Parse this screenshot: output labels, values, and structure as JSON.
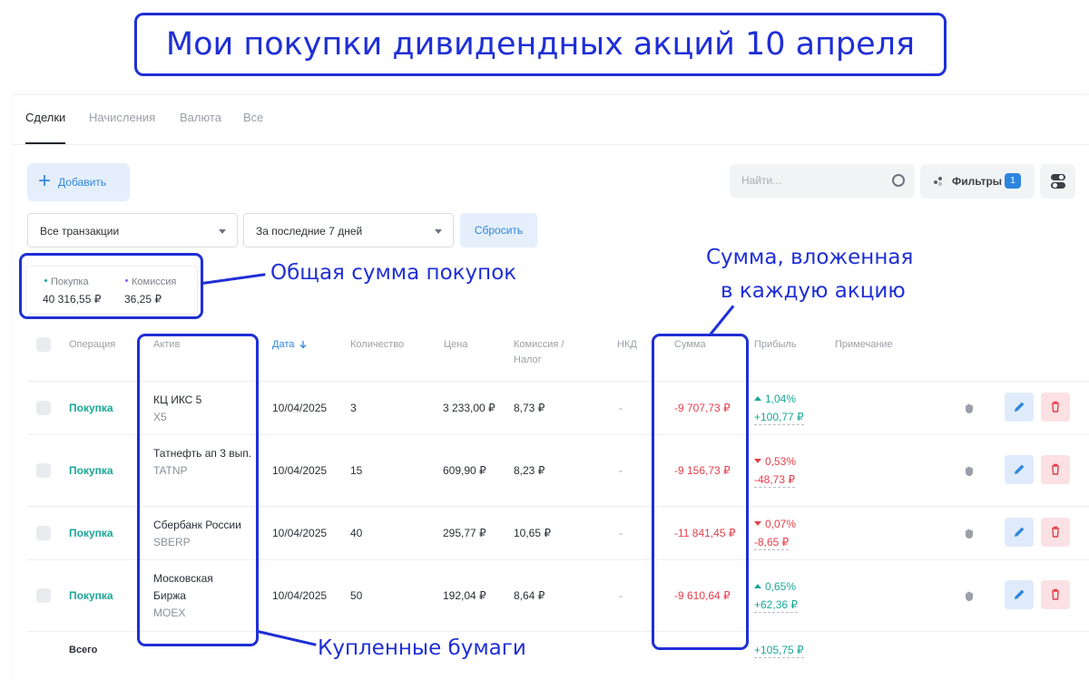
{
  "banner": {
    "title": "Мои покупки дивидендных акций 10 апреля"
  },
  "tabs": [
    {
      "label": "Сделки",
      "active": true
    },
    {
      "label": "Начисления",
      "active": false
    },
    {
      "label": "Валюта",
      "active": false
    },
    {
      "label": "Все",
      "active": false
    }
  ],
  "toolbar": {
    "add_label": "Добавить",
    "search_placeholder": "Найти...",
    "filters_label": "Фильтры",
    "filters_count": "1",
    "transaction_type": "Все транзакции",
    "period": "За последние 7 дней",
    "reset_label": "Сбросить"
  },
  "summary": {
    "buy_label": "Покупка",
    "buy_value": "40 316,55 ₽",
    "buy_color": "#1aa89a",
    "commission_label": "Комиссия",
    "commission_value": "36,25 ₽",
    "commission_color": "#8b5cf6"
  },
  "columns": {
    "operation": "Операция",
    "asset": "Актив",
    "date": "Дата",
    "quantity": "Количество",
    "price": "Цена",
    "commission_1": "Комиссия /",
    "commission_2": "Налог",
    "nkd": "НКД",
    "sum": "Сумма",
    "profit": "Прибыль",
    "note": "Примечание"
  },
  "rows": [
    {
      "operation": "Покупка",
      "asset_name": "КЦ ИКС 5",
      "ticker": "X5",
      "date": "10/04/2025",
      "quantity": "3",
      "price": "3 233,00 ₽",
      "commission": "8,73 ₽",
      "nkd": "-",
      "sum": "-9 707,73 ₽",
      "profit_pct": "1,04%",
      "profit_abs": "+100,77 ₽",
      "direction": "up"
    },
    {
      "operation": "Покупка",
      "asset_name": "Татнефть ап 3 вып.",
      "ticker": "TATNP",
      "date": "10/04/2025",
      "quantity": "15",
      "price": "609,90 ₽",
      "commission": "8,23 ₽",
      "nkd": "-",
      "sum": "-9 156,73 ₽",
      "profit_pct": "0,53%",
      "profit_abs": "-48,73 ₽",
      "direction": "down"
    },
    {
      "operation": "Покупка",
      "asset_name": "Сбербанк России",
      "ticker": "SBERP",
      "date": "10/04/2025",
      "quantity": "40",
      "price": "295,77 ₽",
      "commission": "10,65 ₽",
      "nkd": "-",
      "sum": "-11 841,45 ₽",
      "profit_pct": "0,07%",
      "profit_abs": "-8,65 ₽",
      "direction": "down"
    },
    {
      "operation": "Покупка",
      "asset_name": "Московская Биржа",
      "ticker": "MOEX",
      "date": "10/04/2025",
      "quantity": "50",
      "price": "192,04 ₽",
      "commission": "8,64 ₽",
      "nkd": "-",
      "sum": "-9 610,64 ₽",
      "profit_pct": "0,65%",
      "profit_abs": "+62,36 ₽",
      "direction": "up"
    }
  ],
  "total": {
    "label": "Всего",
    "profit": "+105,75 ₽"
  },
  "annotations": {
    "total_buys": "Общая сумма покупок",
    "sum_per_stock_1": "Сумма, вложенная",
    "sum_per_stock_2": "в каждую акцию",
    "bought_papers": "Купленные бумаги"
  },
  "colors": {
    "accent": "#2e86de",
    "annotation": "#1f2fd6",
    "positive": "#1aa89a",
    "negative": "#e53e4a"
  },
  "icons": {
    "add": "plus-icon",
    "search": "search-icon",
    "filters": "filter-dots-icon",
    "view": "toggle-icon",
    "sort": "arrow-down-icon",
    "drag": "hand-icon",
    "edit": "pencil-icon",
    "delete": "trash-icon"
  }
}
